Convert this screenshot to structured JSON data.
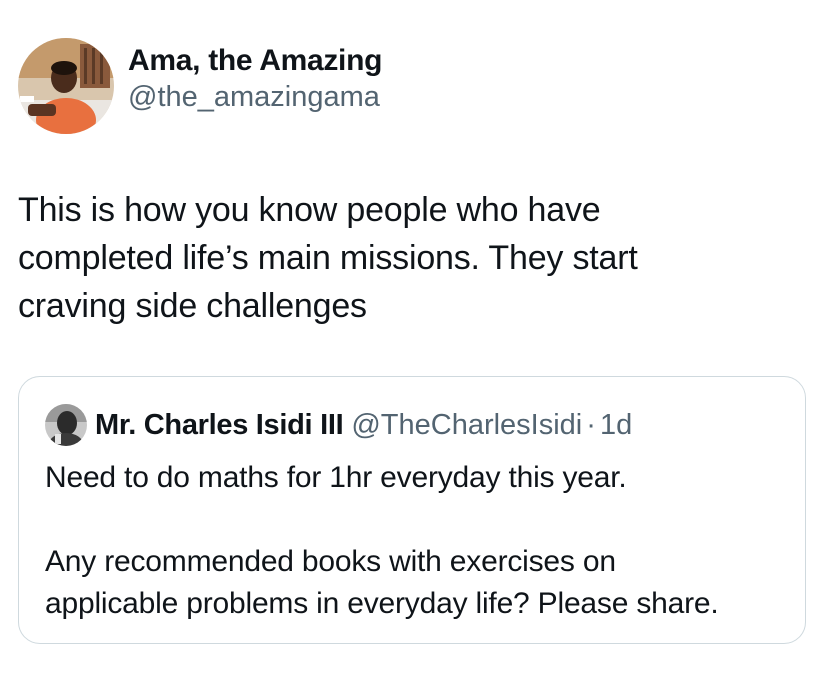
{
  "author": {
    "display_name": "Ama, the Amazing",
    "handle": "@the_amazingama",
    "avatar_icon": "user-avatar-photo"
  },
  "tweet": {
    "text": "This is how you know people who have\ncompleted life’s main missions. They start\ncraving side challenges"
  },
  "quote": {
    "display_name": "Mr. Charles Isidi III",
    "handle": "@TheCharlesIsidi",
    "separator": "·",
    "time": "1d",
    "text": "Need to do maths for 1hr everyday this year.\n\nAny recommended books with exercises on\napplicable problems in everyday life? Please share.",
    "avatar_icon": "user-avatar-photo"
  },
  "colors": {
    "text": "#0f1419",
    "secondary": "#536471",
    "border": "#cfd9de",
    "background": "#ffffff"
  }
}
